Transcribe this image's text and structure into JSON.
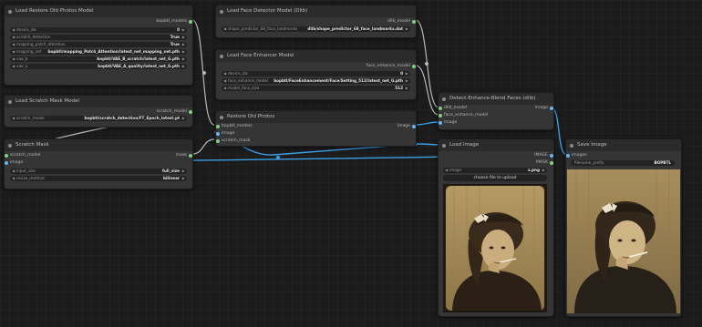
{
  "nodes": {
    "restore_model": {
      "title": "Load Restore Old Photos Model",
      "output": "bopbtl_models",
      "widgets": [
        {
          "label": "device_ids",
          "value": "0"
        },
        {
          "label": "scratch_detection",
          "value": "True"
        },
        {
          "label": "mapping_patch_attention",
          "value": "True"
        },
        {
          "label": "mapping_net",
          "value": "bopbtl/mapping_Patch_Attention/latest_net_mapping_net.pth"
        },
        {
          "label": "vae_b",
          "value": "bopbtl/VAE_B_scratch/latest_net_G.pth"
        },
        {
          "label": "vae_a",
          "value": "bopbtl/VAE_A_quality/latest_net_G.pth"
        }
      ]
    },
    "scratch_mask_model": {
      "title": "Load Scratch Mask Model",
      "output": "scratch_model",
      "widgets": [
        {
          "label": "scratch_model",
          "value": "bopbtl/scratch_detection/FT_Epoch_latest.pt"
        }
      ]
    },
    "scratch_mask": {
      "title": "Scratch Mask",
      "inputs": [
        "scratch_model",
        "image"
      ],
      "output": "mask",
      "widgets": [
        {
          "label": "input_size",
          "value": "full_size"
        },
        {
          "label": "resize_method",
          "value": "bilinear"
        }
      ]
    },
    "face_detector": {
      "title": "Load Face Detector Model (Dlib)",
      "output": "dlib_model",
      "widgets": [
        {
          "label": "shape_predictor_68_face_landmarks",
          "value": "dlib/shape_predictor_68_face_landmarks.dat"
        }
      ]
    },
    "face_enhancer": {
      "title": "Load Face Enhancer Model",
      "output": "face_enhance_model",
      "widgets": [
        {
          "label": "device_ids",
          "value": "0"
        },
        {
          "label": "face_enhance_model",
          "value": "bopbtl/FaceEnhancement/Face/Setting_512/latest_net_G.pth"
        },
        {
          "label": "model_face_size",
          "value": "512"
        }
      ]
    },
    "restore_old": {
      "title": "Restore Old Photos",
      "inputs": [
        "bopbtl_models",
        "image",
        "scratch_mask"
      ],
      "output": "image"
    },
    "detect_enhance": {
      "title": "Detect-Enhance-Blend Faces (dlib)",
      "inputs": [
        "dlib_model",
        "face_enhance_model",
        "image"
      ],
      "output": "image"
    },
    "load_image": {
      "title": "Load Image",
      "outputs": [
        "IMAGE",
        "MASK"
      ],
      "widgets": [
        {
          "label": "image",
          "value": "s.png"
        }
      ],
      "upload_label": "choose file to upload"
    },
    "save_image": {
      "title": "Save Image",
      "inputs": [
        "images"
      ],
      "widgets": [
        {
          "label": "filename_prefix",
          "value": "BOPBTL"
        }
      ]
    }
  },
  "colors": {
    "canvas": "#1b1b1b",
    "node": "#353535",
    "title_bar": "#2b2b2b",
    "image_socket": "#64b5f6",
    "model_socket": "#7ed27e",
    "wire_image": "#3b9ee6",
    "wire_other": "#b8b8b8"
  }
}
